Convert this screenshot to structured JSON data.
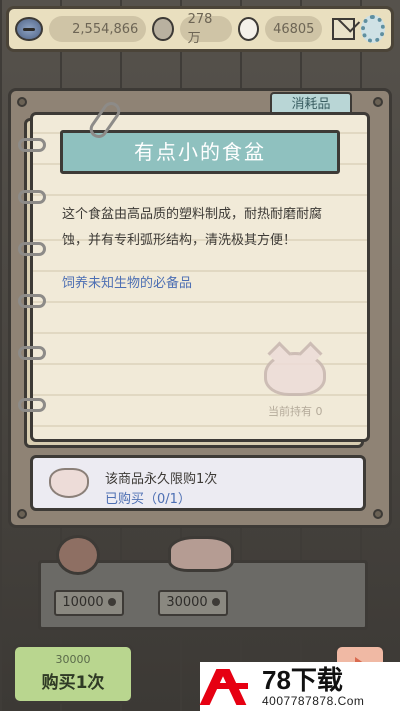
{
  "topbar": {
    "coins": "2,554,866",
    "currency2": "278万",
    "currency3": "46805",
    "icons": [
      "coin-icon",
      "speech-bubble-icon",
      "white-bubble-icon",
      "mail-icon",
      "gear-icon"
    ]
  },
  "category_tab": "消耗品",
  "item": {
    "title": "有点小的食盆",
    "description": "这个食盆由高品质的塑料制成，耐热耐磨耐腐蚀，并有专利弧形结构，清洗极其方便！",
    "tagline": "饲养未知生物的必备品",
    "owned_label": "当前持有 0"
  },
  "limit": {
    "text": "该商品永久限购1次",
    "count": "已购买（0/1）"
  },
  "shelf": {
    "price_left": "10000",
    "price_right": "30000"
  },
  "buy": {
    "cost": "30000",
    "label": "购买1次"
  },
  "watermark": {
    "brand": "78下载",
    "url": "4007787878.Com"
  },
  "colors": {
    "banner": "#8fc1bf",
    "tagline": "#4d6fb3",
    "buy_button": "#b9d68f",
    "paper": "#f1ead8",
    "watermark_red": "#e60012"
  }
}
